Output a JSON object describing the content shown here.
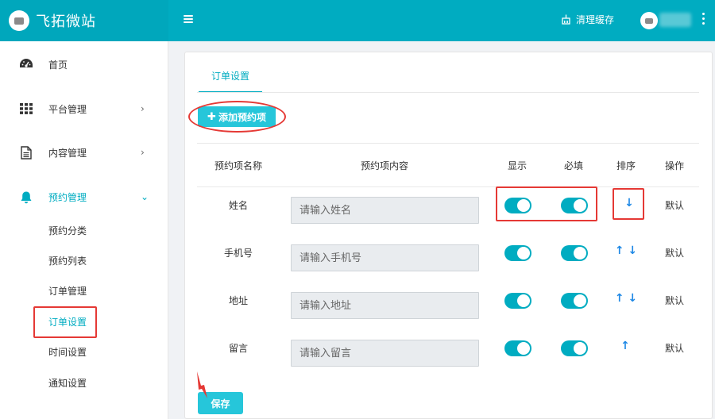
{
  "header": {
    "brand": "飞拓微站",
    "clear_cache": "清理缓存"
  },
  "sidebar": {
    "items": [
      {
        "label": "首页",
        "icon": "dashboard-icon"
      },
      {
        "label": "平台管理",
        "icon": "grid-icon"
      },
      {
        "label": "内容管理",
        "icon": "document-icon"
      },
      {
        "label": "预约管理",
        "icon": "bell-icon"
      }
    ],
    "expand_arrow": "›",
    "collapse_arrow": "⌄",
    "sub_items": [
      "预约分类",
      "预约列表",
      "订单管理",
      "订单设置",
      "时间设置",
      "通知设置"
    ]
  },
  "main": {
    "tab": "订单设置",
    "add_button": "添加预约项",
    "columns": {
      "name": "预约项名称",
      "content": "预约项内容",
      "show": "显示",
      "required": "必填",
      "sort": "排序",
      "action": "操作"
    },
    "rows": [
      {
        "name": "姓名",
        "placeholder": "请输入姓名",
        "show": true,
        "required": true,
        "sort": "↓",
        "action": "默认"
      },
      {
        "name": "手机号",
        "placeholder": "请输入手机号",
        "show": true,
        "required": true,
        "sort": "↑ ↓",
        "action": "默认"
      },
      {
        "name": "地址",
        "placeholder": "请输入地址",
        "show": true,
        "required": true,
        "sort": "↑ ↓",
        "action": "默认"
      },
      {
        "name": "留言",
        "placeholder": "请输入留言",
        "show": true,
        "required": true,
        "sort": "↑",
        "action": "默认"
      }
    ],
    "save_button": "保存"
  },
  "colors": {
    "topbar": "#00acc1",
    "accent": "#00acc1",
    "button": "#26c6da",
    "highlight": "#e53935",
    "sort_arrow": "#1e88e5"
  }
}
